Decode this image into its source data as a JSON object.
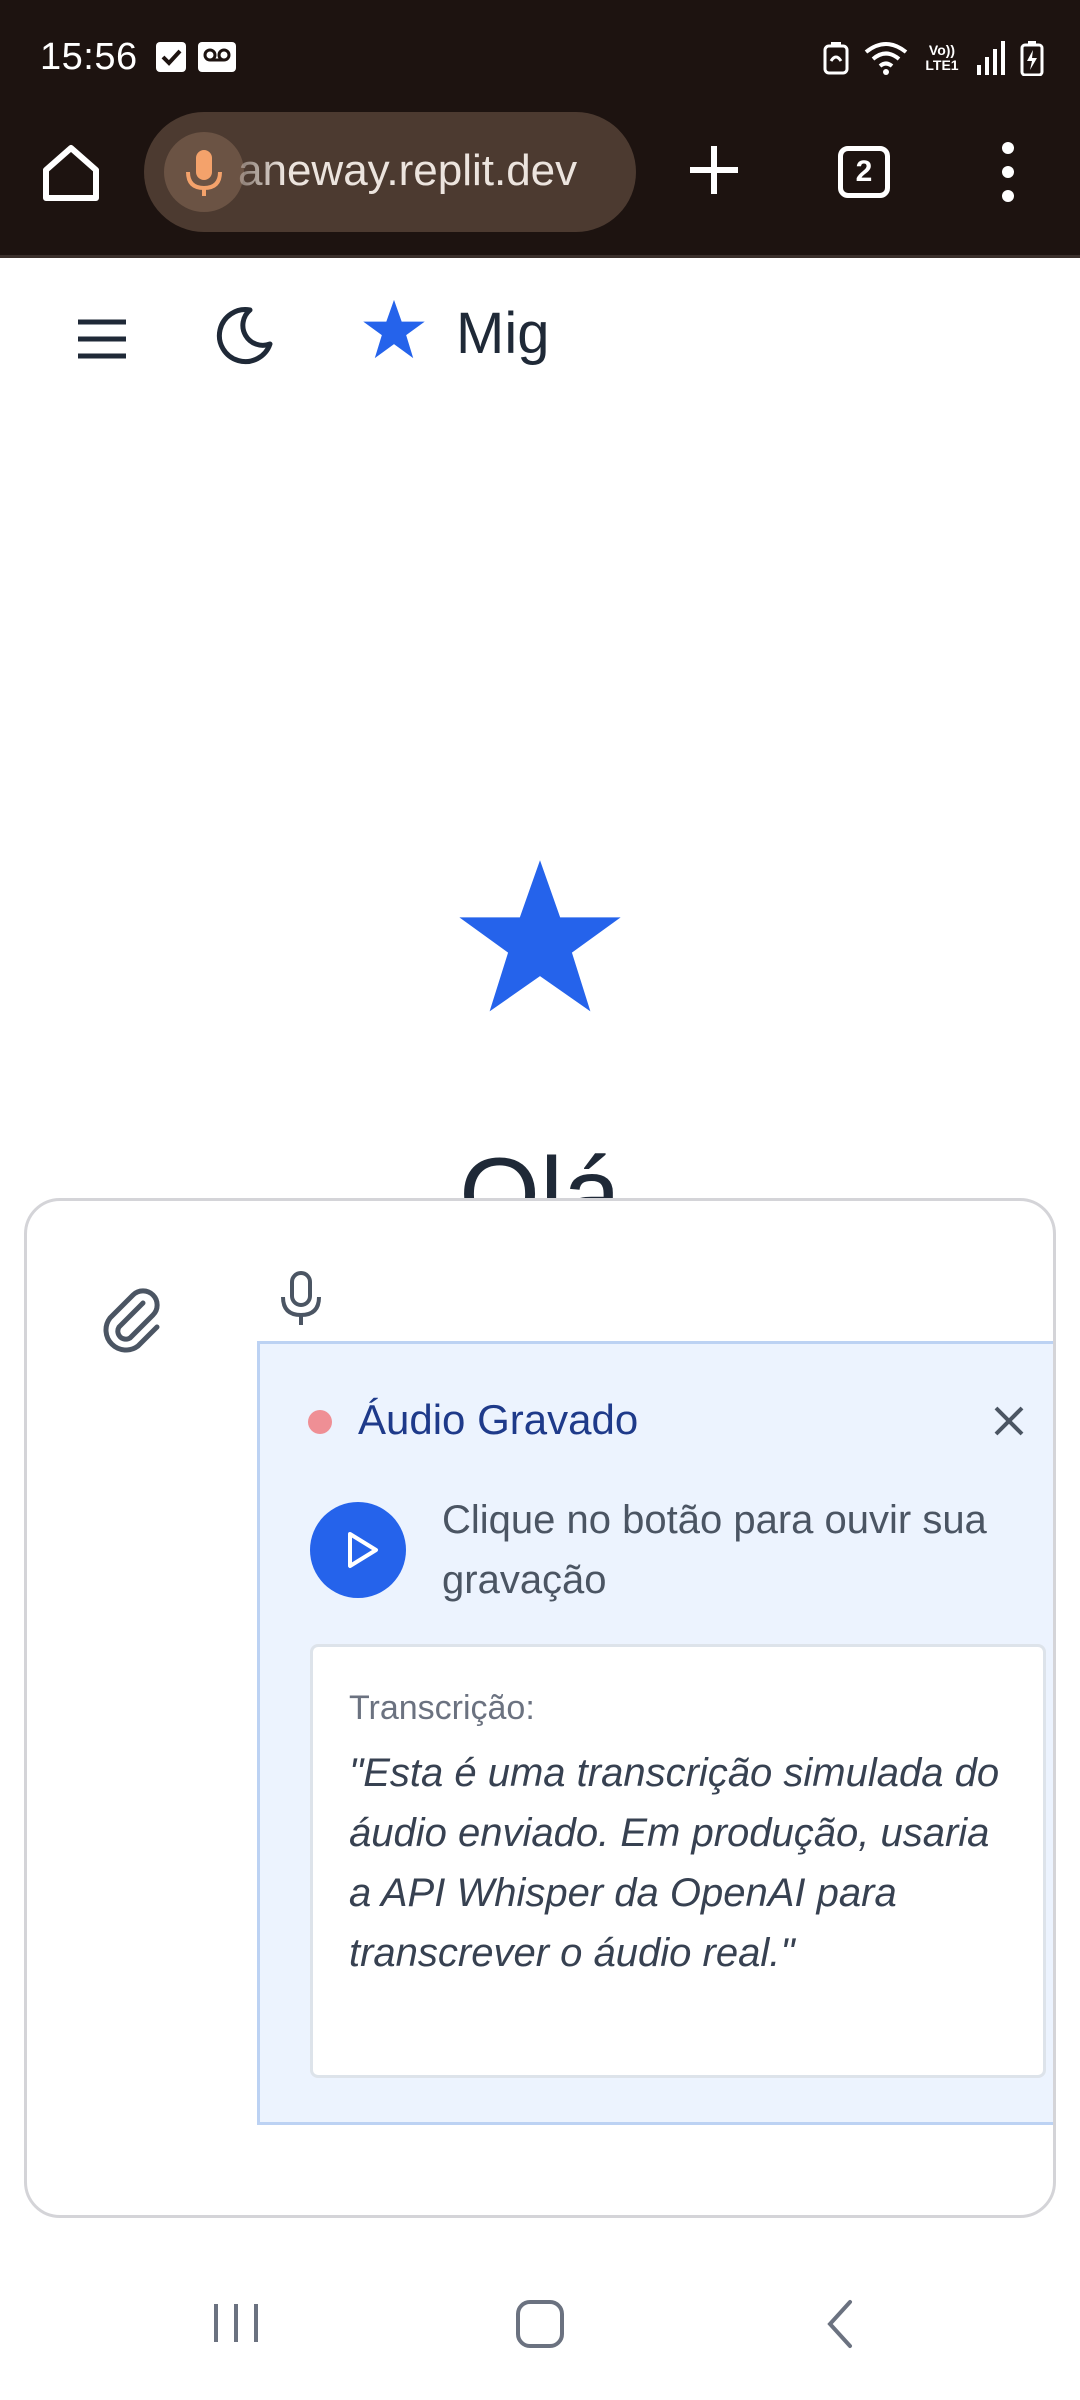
{
  "status_bar": {
    "time": "15:56",
    "network_label": "Vo)) LTE1",
    "icons": [
      "checkbox-notification-icon",
      "voicemail-icon",
      "battery-saver-icon",
      "wifi-icon",
      "signal-icon",
      "battery-charging-icon"
    ]
  },
  "browser": {
    "url": "aneway.replit.dev",
    "tab_count": "2",
    "toolbar_icons": [
      "home-icon",
      "mic-icon",
      "plus-icon",
      "tabs-icon",
      "more-vert-icon"
    ]
  },
  "app_header": {
    "brand_name": "Mig",
    "icons": [
      "menu-icon",
      "moon-icon",
      "star-icon"
    ]
  },
  "hero": {
    "greeting": "Olá"
  },
  "chat_input": {
    "icons": [
      "paperclip-icon",
      "mic-icon"
    ]
  },
  "audio_panel": {
    "title": "Áudio Gravado",
    "play_hint": "Clique no botão para ouvir sua gravação",
    "transcript_label": "Transcrição:",
    "transcript_text": "\"Esta é uma transcrição simulada do áudio enviado. Em produção, usaria a API Whisper da OpenAI para transcrever o áudio real.\""
  },
  "colors": {
    "browser_bar": "#1d1310",
    "accent_blue": "#2563eb",
    "panel_bg": "#ecf3fe",
    "recording_dot": "#ef8f95",
    "mic_orange": "#f4a26b"
  }
}
